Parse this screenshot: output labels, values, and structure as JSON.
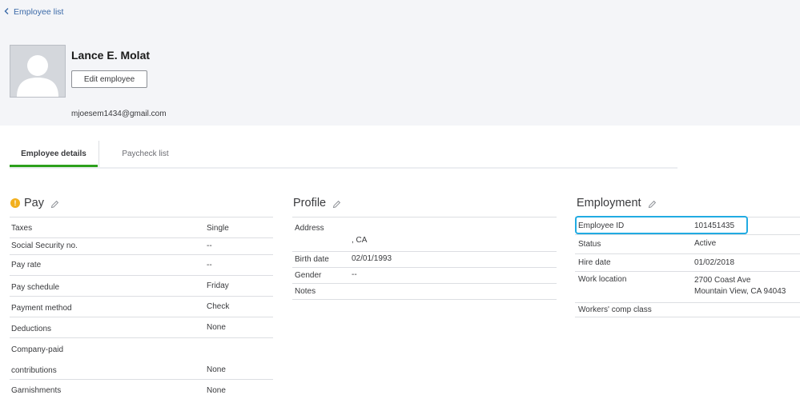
{
  "nav": {
    "back_label": "Employee list"
  },
  "employee": {
    "name": "Lance E. Molat",
    "edit_label": "Edit employee",
    "email": "mjoesem1434@gmail.com"
  },
  "tabs": [
    {
      "label": "Employee details",
      "active": true
    },
    {
      "label": "Paycheck list",
      "active": false
    }
  ],
  "pay": {
    "title": "Pay",
    "rows": [
      {
        "label": "Taxes",
        "value": "Single"
      },
      {
        "label": "Social Security no.",
        "value": "--"
      },
      {
        "label": "Pay rate",
        "value": "--"
      },
      {
        "label": "Pay schedule",
        "value": "Friday"
      },
      {
        "label": "Payment method",
        "value": "Check"
      },
      {
        "label": "Deductions",
        "value": "None"
      },
      {
        "label": "Company-paid",
        "label2": "contributions",
        "value": "None"
      },
      {
        "label": "Garnishments",
        "value": "None"
      }
    ]
  },
  "profile": {
    "title": "Profile",
    "rows": [
      {
        "label": "Address",
        "value": ", CA"
      },
      {
        "label": "Birth date",
        "value": "02/01/1993"
      },
      {
        "label": "Gender",
        "value": "--"
      },
      {
        "label": "Notes",
        "value": ""
      }
    ]
  },
  "employment": {
    "title": "Employment",
    "rows": [
      {
        "label": "Employee ID",
        "value": "101451435"
      },
      {
        "label": "Status",
        "value": "Active"
      },
      {
        "label": "Hire date",
        "value": "01/02/2018"
      },
      {
        "label": "Work location",
        "value": "2700 Coast Ave",
        "value2": "Mountain View, CA 94043"
      },
      {
        "label": "Workers' comp class",
        "value": ""
      }
    ]
  },
  "colors": {
    "accent_green": "#2ca01c",
    "link_blue": "#3b6aa8",
    "highlight": "#21abe2",
    "warning": "#f2b01e"
  }
}
